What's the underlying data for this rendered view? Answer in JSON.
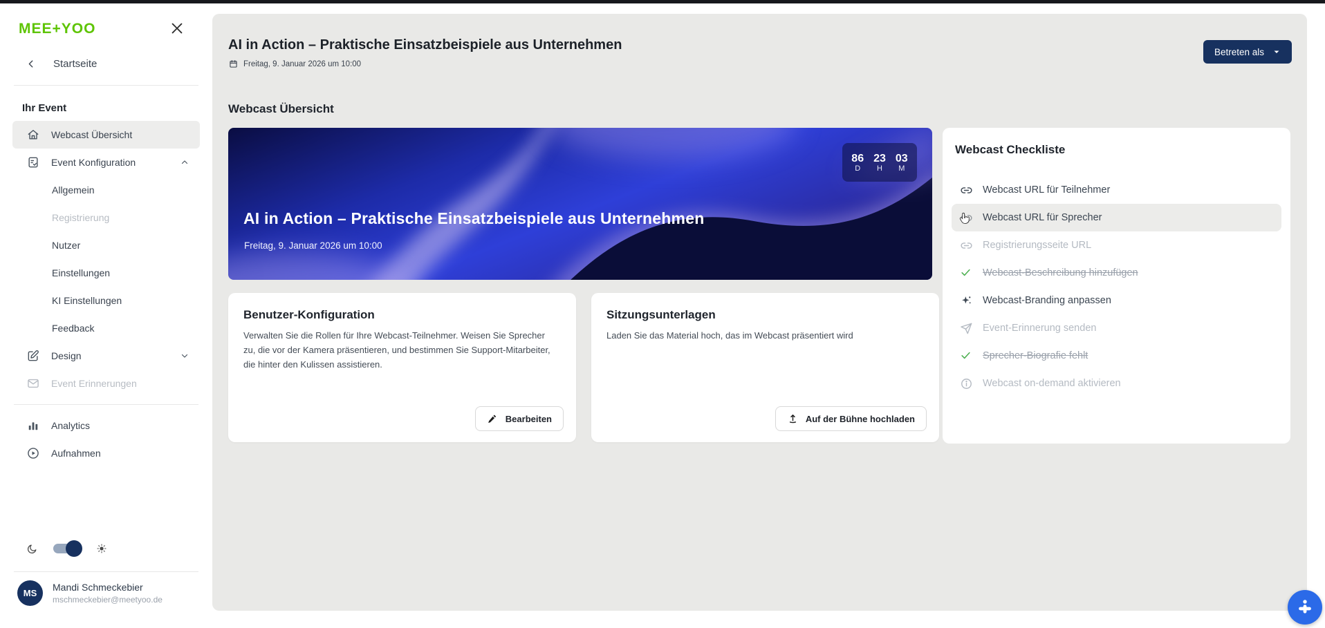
{
  "colors": {
    "brand_green": "#5ec404",
    "navy": "#17315f",
    "fab_blue": "#2b6ae8",
    "check_green": "#4caf50",
    "panel_grey": "#e9e9e7"
  },
  "sidebar": {
    "logo_text": "MEE+YOO",
    "back_label": "Startseite",
    "section_heading": "Ihr Event",
    "items": {
      "webcast_uebersicht": "Webcast Übersicht",
      "event_konfiguration": "Event Konfiguration",
      "allgemein": "Allgemein",
      "registrierung": "Registrierung",
      "nutzer": "Nutzer",
      "einstellungen": "Einstellungen",
      "ki_einstellungen": "KI Einstellungen",
      "feedback": "Feedback",
      "design": "Design",
      "event_erinnerungen": "Event Erinnerungen",
      "analytics": "Analytics",
      "aufnahmen": "Aufnahmen"
    },
    "user": {
      "initials": "MS",
      "name": "Mandi Schmeckebier",
      "email": "mschmeckebier@meetyoo.de"
    }
  },
  "header": {
    "title": "AI in Action – Praktische Einsatzbeispiele aus Unternehmen",
    "date": "Freitag, 9. Januar 2026 um 10:00",
    "enter_as_label": "Betreten als"
  },
  "overview": {
    "section_title": "Webcast Übersicht",
    "banner": {
      "title": "AI in Action – Praktische Einsatzbeispiele aus Unternehmen",
      "date": "Freitag, 9. Januar 2026 um 10:00",
      "countdown": [
        {
          "value": "86",
          "unit": "D"
        },
        {
          "value": "23",
          "unit": "H"
        },
        {
          "value": "03",
          "unit": "M"
        }
      ]
    },
    "cards": [
      {
        "title": "Benutzer-Konfiguration",
        "description": "Verwalten Sie die Rollen für Ihre Webcast-Teilnehmer. Weisen Sie Sprecher zu, die vor der Kamera präsentieren, und bestimmen Sie Support-Mitarbeiter, die hinter den Kulissen assistieren.",
        "button_label": "Bearbeiten"
      },
      {
        "title": "Sitzungsunterlagen",
        "description": "Laden Sie das Material hoch, das im Webcast präsentiert wird",
        "button_label": "Auf der Bühne hochladen"
      }
    ]
  },
  "checklist": {
    "title": "Webcast Checkliste",
    "items": [
      {
        "label": "Webcast URL für Teilnehmer",
        "icon": "link",
        "state": "default"
      },
      {
        "label": "Webcast URL für Sprecher",
        "icon": "link",
        "state": "hovered"
      },
      {
        "label": "Registrierungsseite URL",
        "icon": "link",
        "state": "disabled"
      },
      {
        "label": "Webcast-Beschreibung hinzufügen",
        "icon": "check",
        "state": "done"
      },
      {
        "label": "Webcast-Branding anpassen",
        "icon": "sparkle",
        "state": "default"
      },
      {
        "label": "Event-Erinnerung senden",
        "icon": "send",
        "state": "disabled"
      },
      {
        "label": "Sprecher-Biografie fehlt",
        "icon": "check",
        "state": "done"
      },
      {
        "label": "Webcast on-demand aktivieren",
        "icon": "info",
        "state": "disabled"
      }
    ]
  }
}
